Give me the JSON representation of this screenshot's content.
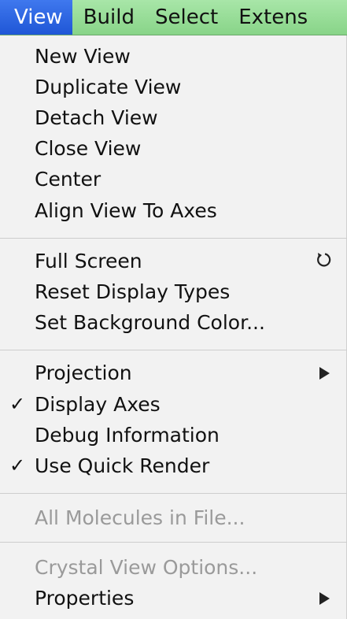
{
  "menubar": {
    "items": [
      "View",
      "Build",
      "Select",
      "Extens"
    ]
  },
  "menu": {
    "group1": [
      "New View",
      "Duplicate View",
      "Detach View",
      "Close View",
      "Center",
      "Align View To Axes"
    ],
    "group2": [
      "Full Screen",
      "Reset Display Types",
      "Set Background Color..."
    ],
    "group3": [
      "Projection",
      "Display Axes",
      "Debug Information",
      "Use Quick Render"
    ],
    "group4": [
      "All Molecules in File..."
    ],
    "group5": [
      "Crystal View Options...",
      "Properties"
    ],
    "check_glyph": "✓"
  }
}
